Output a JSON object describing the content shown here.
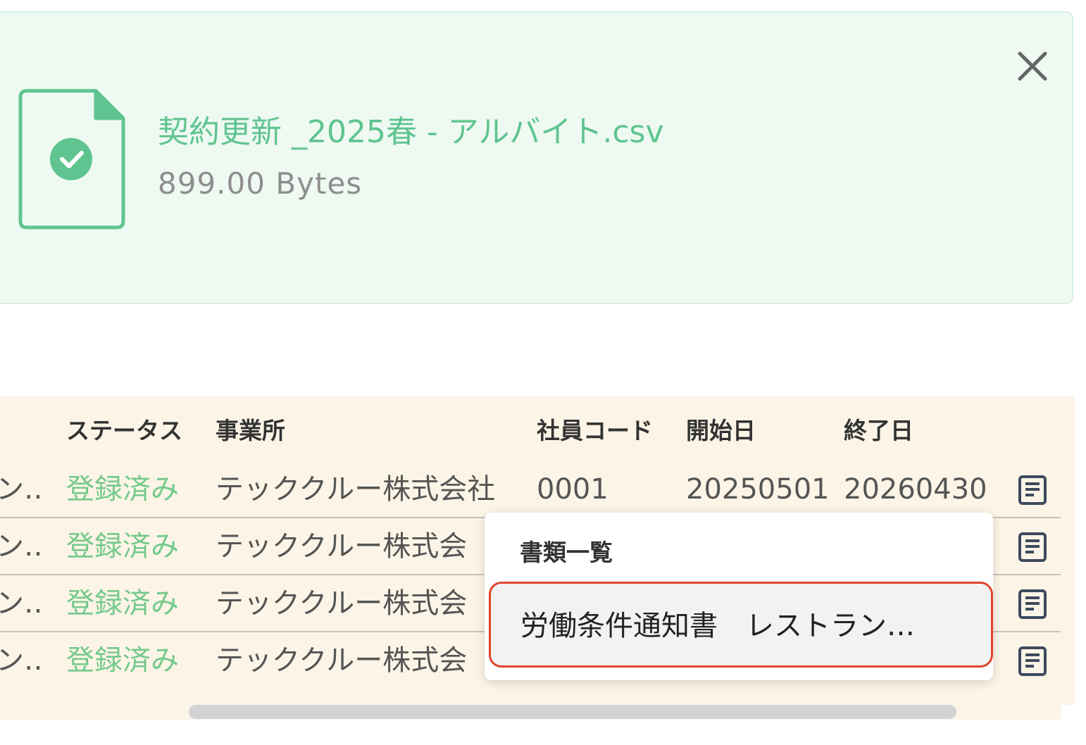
{
  "upload": {
    "file_name": "契約更新 _2025春 - アルバイト.csv",
    "file_size": "899.00 Bytes",
    "icon": "file-check-icon",
    "close_icon": "close-icon",
    "accent_color": "#5fc48f"
  },
  "table": {
    "headers": [
      "ステータス",
      "事業所",
      "社員コード",
      "開始日",
      "終了日"
    ],
    "rows": [
      {
        "lead": "ン…",
        "status": "登録済み",
        "office": "テッククルー株式会社",
        "employee_code": "0001",
        "start_date": "20250501",
        "end_date": "20260430"
      },
      {
        "lead": "ン…",
        "status": "登録済み",
        "office": "テッククルー株式会"
      },
      {
        "lead": "ン…",
        "status": "登録済み",
        "office": "テッククルー株式会"
      },
      {
        "lead": "ン…",
        "status": "登録済み",
        "office": "テッククルー株式会"
      }
    ],
    "row_action_icon": "document-list-icon",
    "status_color": "#74c98a"
  },
  "popover": {
    "title": "書類一覧",
    "items": [
      {
        "label": "労働条件通知書　レストラン…"
      }
    ],
    "highlight_color": "#e0452f"
  }
}
